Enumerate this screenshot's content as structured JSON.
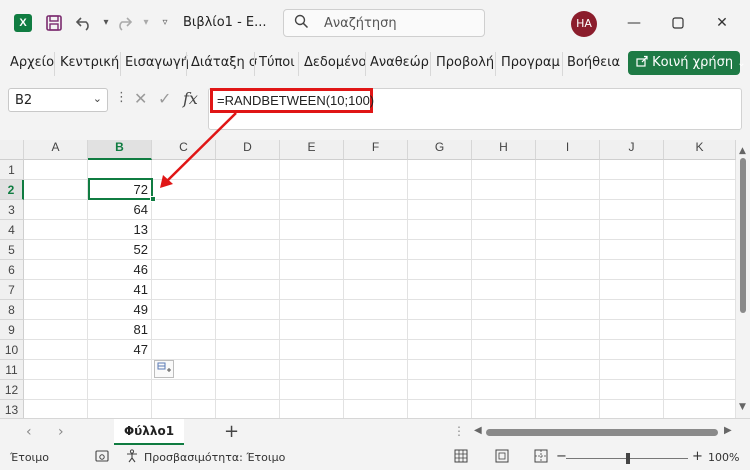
{
  "titlebar": {
    "app_logo": "X",
    "save_icon": "save-icon",
    "undo_icon": "undo-icon",
    "redo_icon": "redo-icon",
    "customize_icon": "chevron-down-icon",
    "workbook_name": "Βιβλίο1 - Ε...",
    "search_placeholder": "Αναζήτηση",
    "user_initials": "HA"
  },
  "ribbon": {
    "tabs": [
      "Αρχείο",
      "Κεντρική",
      "Εισαγωγή",
      "Διάταξη σ",
      "Τύποι",
      "Δεδομένο",
      "Αναθεώρ",
      "Προβολή",
      "Προγραμ",
      "Βοήθεια"
    ],
    "share_label": "Κοινή χρήση"
  },
  "formula_bar": {
    "name_box": "B2",
    "formula": "=RANDBETWEEN(10;100)",
    "fx_label": "fx"
  },
  "grid": {
    "columns": [
      "A",
      "B",
      "C",
      "D",
      "E",
      "F",
      "G",
      "H",
      "I",
      "J",
      "K"
    ],
    "rows": [
      "1",
      "2",
      "3",
      "4",
      "5",
      "6",
      "7",
      "8",
      "9",
      "10",
      "11",
      "12",
      "13"
    ],
    "selected_column": "B",
    "selected_row": "2",
    "column_b_values": [
      "72",
      "64",
      "13",
      "52",
      "46",
      "41",
      "49",
      "81",
      "47"
    ]
  },
  "sheets": {
    "tabs": [
      "Φύλλο1"
    ],
    "active": "Φύλλο1"
  },
  "statusbar": {
    "ready": "Έτοιμο",
    "accessibility": "Προσβασιμότητα: Έτοιμο",
    "zoom": "100%"
  },
  "colors": {
    "excel_green": "#107c41",
    "share_button": "#1e7a45",
    "annotation_red": "#e01616",
    "avatar": "#8b1d2c"
  }
}
